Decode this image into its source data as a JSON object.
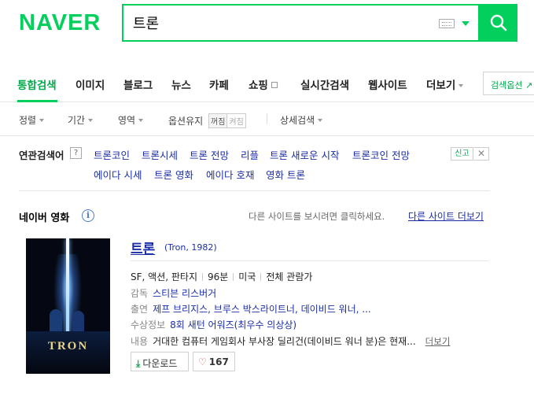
{
  "header": {
    "logo": "NAVER",
    "logo_color": "#03cf5d",
    "search_value": "트론",
    "accent_color": "#03cf5d"
  },
  "tabs": [
    {
      "label": "통합검색",
      "active": true
    },
    {
      "label": "이미지"
    },
    {
      "label": "블로그"
    },
    {
      "label": "뉴스"
    },
    {
      "label": "카페"
    },
    {
      "label": "쇼핑"
    },
    {
      "label": "실시간검색"
    },
    {
      "label": "웹사이트"
    },
    {
      "label": "더보기"
    }
  ],
  "search_options_label": "검색옵션",
  "filters": {
    "sort": "정렬",
    "period": "기간",
    "area": "영역",
    "keep_option": "옵션유지",
    "off": "꺼짐",
    "on": "켜짐",
    "detail": "상세검색"
  },
  "related": {
    "label": "연관검색어",
    "help": "?",
    "report": "신고",
    "row1": [
      "트론코인",
      "트론시세",
      "트론 전망",
      "리플",
      "트론 새로운 시작",
      "트론코인 전망"
    ],
    "row2": [
      "에이다 시세",
      "트론 영화",
      "에이다 호재",
      "영화 트론"
    ]
  },
  "movie_section": {
    "title": "네이버 영화",
    "visit_message": "다른 사이트를 보시려면 클릭하세요.",
    "visit_link": "다른 사이트 더보기"
  },
  "movie": {
    "title": "트론",
    "subtitle": "(Tron, 1982)",
    "poster_title": "TRON",
    "genre": "SF, 액션, 판타지",
    "runtime": "96분",
    "country": "미국",
    "rating": "전체 관람가",
    "director_label": "감독",
    "director": "스티븐 리스버거",
    "cast_label": "출연",
    "cast": "제프 브리지스, 브루스 박스라이트너, 데이비드 워너, ...",
    "award_label": "수상정보",
    "award": "8회 새턴 어워즈(최우수 의상상)",
    "plot_label": "내용",
    "plot": "거대한 컴퓨터 게임회사 부사장 딜리건(데이비드 워너 분)은 현재...",
    "plot_more": "더보기",
    "download": "다운로드",
    "likes": "167"
  }
}
